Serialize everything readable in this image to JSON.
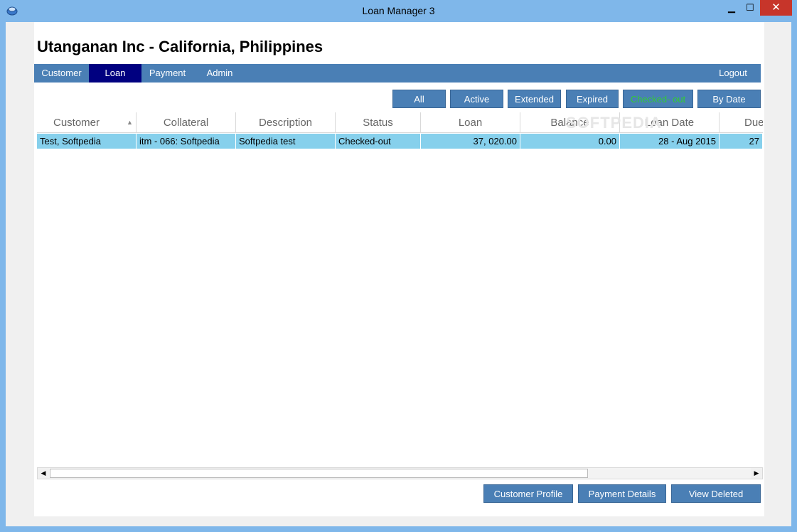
{
  "window": {
    "title": "Loan Manager 3",
    "minimize_glyph": "▁",
    "maximize_glyph": "☐",
    "close_glyph": "✕"
  },
  "company_title": "Utanganan Inc - California, Philippines",
  "nav": {
    "items": [
      {
        "label": "Customer",
        "active": false
      },
      {
        "label": "Loan",
        "active": true
      },
      {
        "label": "Payment",
        "active": false
      },
      {
        "label": "Admin",
        "active": false
      }
    ],
    "logout": "Logout"
  },
  "filters": [
    {
      "label": "All",
      "color": "#ffffff"
    },
    {
      "label": "Active",
      "color": "#ffffff"
    },
    {
      "label": "Extended",
      "color": "#ffffff"
    },
    {
      "label": "Expired",
      "color": "#ffffff"
    },
    {
      "label": "Checked- out",
      "color": "#33cc33"
    },
    {
      "label": "By Date",
      "color": "#ffffff"
    }
  ],
  "table": {
    "columns": [
      "Customer",
      "Collateral",
      "Description",
      "Status",
      "Loan",
      "Balance",
      "Loan Date",
      "Due"
    ],
    "sorted_column_indicator": "▲",
    "rows": [
      [
        "Test, Softpedia",
        "itm - 066: Softpedia",
        "Softpedia test",
        "Checked-out",
        "37, 020.00",
        "0.00",
        "28 - Aug  2015",
        "27"
      ]
    ],
    "selected_row_color": "#86d0ec"
  },
  "watermark": "SOFTPEDIA",
  "scrollbar": {
    "left_arrow": "◀",
    "right_arrow": "▶"
  },
  "bottom_buttons": {
    "customer_profile": "Customer Profile",
    "payment_details": "Payment Details",
    "view_deleted": "View Deleted"
  },
  "colors": {
    "accent": "#4a7fb5",
    "nav_active": "#000080",
    "titlebar": "#7fb7ea"
  }
}
